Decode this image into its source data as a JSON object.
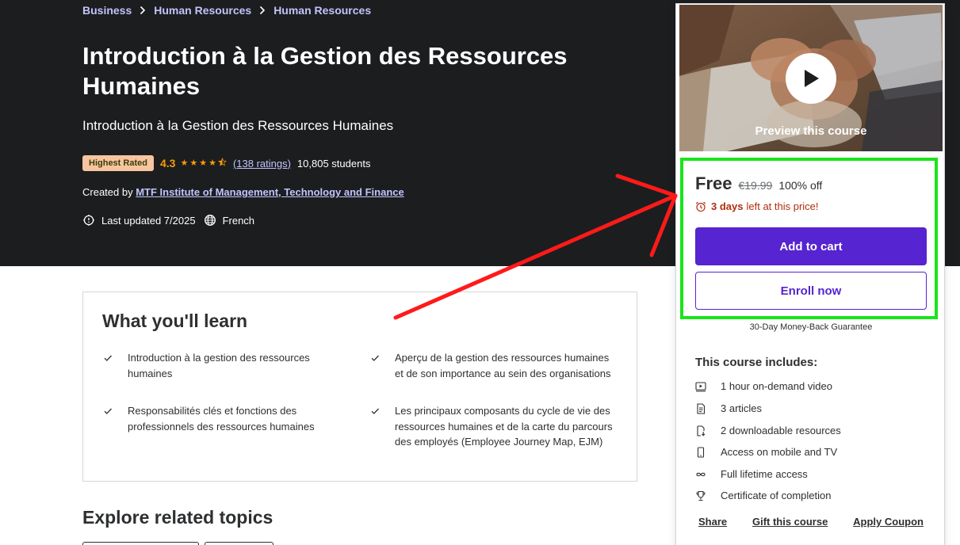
{
  "breadcrumb": [
    "Business",
    "Human Resources",
    "Human Resources"
  ],
  "course": {
    "title": "Introduction à la Gestion des Ressources Humaines",
    "subtitle": "Introduction à la Gestion des Ressources Humaines",
    "badge": "Highest Rated",
    "rating": "4.3",
    "stars_value": 4.3,
    "ratings_count": "(138 ratings)",
    "students": "10,805 students",
    "created_by_label": "Created by",
    "instructor": "MTF Institute of Management, Technology and Finance",
    "last_updated": "Last updated 7/2025",
    "language": "French"
  },
  "learn": {
    "title": "What you'll learn",
    "items": [
      "Introduction à la gestion des ressources humaines",
      "Aperçu de la gestion des ressources humaines et de son importance au sein des organisations",
      "Responsabilités clés et fonctions des professionnels des ressources humaines",
      "Les principaux composants du cycle de vie des ressources humaines et de la carte du parcours des employés (Employee Journey Map, EJM)"
    ]
  },
  "related": {
    "title": "Explore related topics"
  },
  "sidebar": {
    "preview_label": "Preview this course",
    "price": "Free",
    "original_price": "€19.99",
    "discount": "100% off",
    "countdown_bold": "3 days",
    "countdown_rest": "left at this price!",
    "add_to_cart": "Add to cart",
    "enroll_now": "Enroll now",
    "guarantee": "30-Day Money-Back Guarantee",
    "includes_title": "This course includes:",
    "includes": [
      {
        "icon": "video-icon",
        "label": "1 hour on-demand video"
      },
      {
        "icon": "article-icon",
        "label": "3 articles"
      },
      {
        "icon": "download-icon",
        "label": "2 downloadable resources"
      },
      {
        "icon": "mobile-icon",
        "label": "Access on mobile and TV"
      },
      {
        "icon": "infinity-icon",
        "label": "Full lifetime access"
      },
      {
        "icon": "trophy-icon",
        "label": "Certificate of completion"
      }
    ],
    "links": {
      "share": "Share",
      "gift": "Gift this course",
      "coupon": "Apply Coupon"
    }
  },
  "colors": {
    "hero_bg": "#1c1d1f",
    "accent": "#5624d0",
    "link": "#c0c4fc",
    "star": "#f69c08",
    "countdown": "#b32d0f",
    "highlight": "#1be41b",
    "arrow": "#ff1a1a"
  }
}
